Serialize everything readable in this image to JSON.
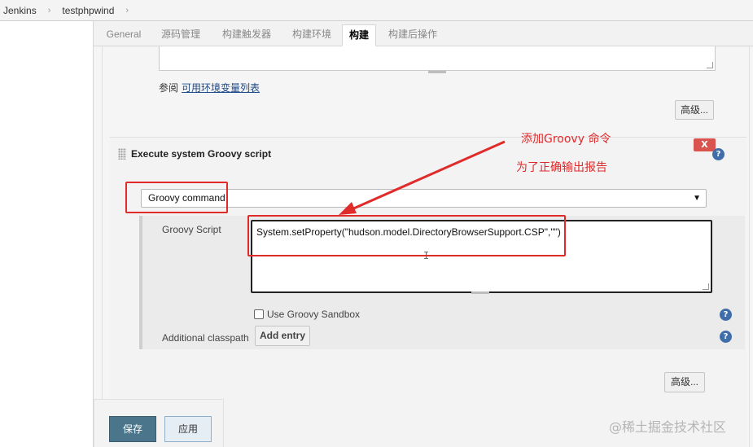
{
  "breadcrumb": {
    "items": [
      "Jenkins",
      "testphpwind"
    ],
    "separator": "›"
  },
  "tabs": [
    {
      "label": "General"
    },
    {
      "label": "源码管理"
    },
    {
      "label": "构建触发器"
    },
    {
      "label": "构建环境"
    },
    {
      "label": "构建",
      "active": true
    },
    {
      "label": "构建后操作"
    }
  ],
  "env": {
    "prefix": "参阅",
    "link": "可用环境变量列表"
  },
  "advanced_button": "高级...",
  "groovy_step": {
    "title": "Execute system Groovy script",
    "close_label": "X",
    "select_value": "Groovy command",
    "script_label": "Groovy Script",
    "script_value": "System.setProperty(\"hudson.model.DirectoryBrowserSupport.CSP\",\"\")",
    "sandbox_label": "Use Groovy Sandbox",
    "sandbox_checked": false,
    "classpath_label": "Additional classpath",
    "add_entry_label": "Add entry",
    "advanced_button": "高级..."
  },
  "footer": {
    "save_label": "保存",
    "apply_label": "应用"
  },
  "annotations": {
    "line1": "添加Groovy 命令",
    "line2": "为了正确输出报告"
  },
  "watermark": "@稀土掘金技术社区",
  "colors": {
    "accent_red": "#e02b2b",
    "save_button": "#4b758b",
    "help_icon": "#3f6ea8"
  },
  "icons": {
    "help": "question-circle",
    "dropdown": "chevron-down",
    "cursor": "i-beam"
  }
}
